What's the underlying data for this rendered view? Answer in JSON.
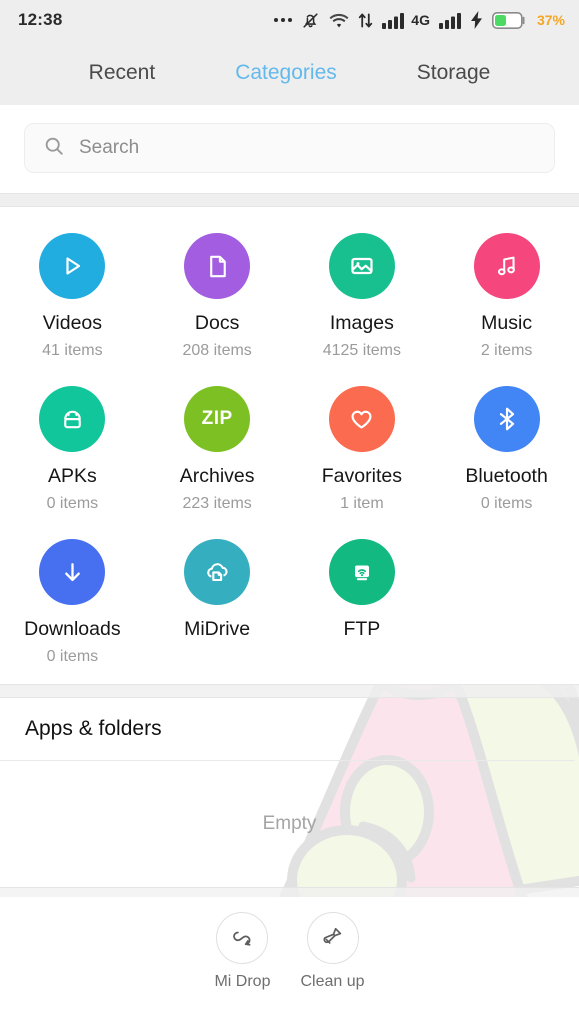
{
  "status_bar": {
    "time": "12:38",
    "icons": [
      "more-dots-icon",
      "bell-muted-icon",
      "wifi-icon",
      "data-transfer-icon",
      "signal-bars-icon",
      "network-type-label",
      "signal-bars-2-icon",
      "charging-bolt-icon",
      "battery-icon"
    ],
    "network_type": "4G",
    "battery_percent": "37%",
    "battery_level": 37,
    "battery_color": "#4CD964",
    "battery_text_color": "#F5A623"
  },
  "tabs": {
    "items": [
      {
        "label": "Recent",
        "active": false
      },
      {
        "label": "Categories",
        "active": true
      },
      {
        "label": "Storage",
        "active": false
      }
    ],
    "active_color": "#64B9EC",
    "inactive_color": "#4a4a4a"
  },
  "search": {
    "placeholder": "Search",
    "value": "",
    "icon": "search-icon"
  },
  "categories": [
    {
      "name": "Videos",
      "count": "41 items",
      "icon": "play-icon",
      "color": "#22ADE0"
    },
    {
      "name": "Docs",
      "count": "208 items",
      "icon": "document-icon",
      "color": "#A25DE0"
    },
    {
      "name": "Images",
      "count": "4125 items",
      "icon": "photo-icon",
      "color": "#18C08F"
    },
    {
      "name": "Music",
      "count": "2 items",
      "icon": "music-note-icon",
      "color": "#F6467E"
    },
    {
      "name": "APKs",
      "count": "0 items",
      "icon": "android-icon",
      "color": "#11C69A"
    },
    {
      "name": "Archives",
      "count": "223 items",
      "icon": "zip-icon",
      "color": "#7DC024",
      "icon_text": "ZIP"
    },
    {
      "name": "Favorites",
      "count": "1 item",
      "icon": "heart-icon",
      "color": "#FB6B4F"
    },
    {
      "name": "Bluetooth",
      "count": "0 items",
      "icon": "bluetooth-icon",
      "color": "#4285F4"
    },
    {
      "name": "Downloads",
      "count": "0 items",
      "icon": "download-icon",
      "color": "#4670F0"
    },
    {
      "name": "MiDrive",
      "count": "",
      "icon": "cloud-file-icon",
      "color": "#35AFC0"
    },
    {
      "name": "FTP",
      "count": "",
      "icon": "ftp-cast-icon",
      "color": "#12B981"
    }
  ],
  "apps_section": {
    "header": "Apps & folders",
    "empty_text": "Empty"
  },
  "bottom_bar": [
    {
      "label": "Mi Drop",
      "icon": "mi-drop-loop-icon"
    },
    {
      "label": "Clean up",
      "icon": "broom-brush-icon"
    }
  ]
}
